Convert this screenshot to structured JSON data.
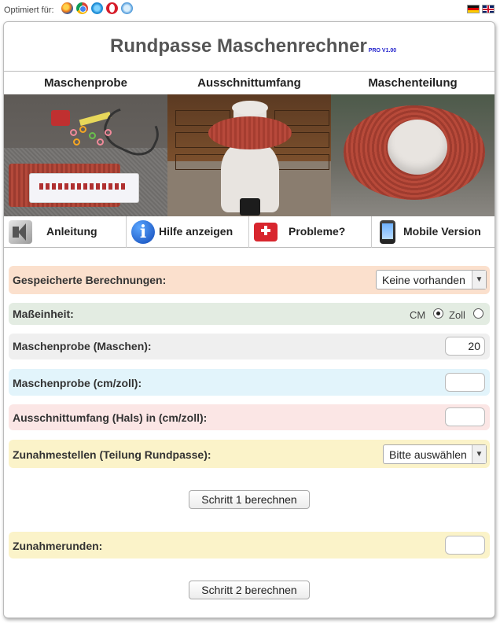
{
  "top": {
    "optimized_label": "Optimiert für:",
    "browsers": [
      "firefox-icon",
      "chrome-icon",
      "ie-icon",
      "opera-icon",
      "safari-icon"
    ],
    "flags": [
      "german-flag-icon",
      "english-flag-icon"
    ]
  },
  "header": {
    "title": "Rundpasse Maschenrechner",
    "version": "PRO V1.00"
  },
  "sections": [
    {
      "label": "Maschenprobe"
    },
    {
      "label": "Ausschnittumfang"
    },
    {
      "label": "Maschenteilung"
    }
  ],
  "nav": [
    {
      "label": "Anleitung",
      "icon": "speaker-icon"
    },
    {
      "label": "Hilfe anzeigen",
      "icon": "info-icon"
    },
    {
      "label": "Probleme?",
      "icon": "first-aid-kit-icon"
    },
    {
      "label": "Mobile Version",
      "icon": "smartphone-icon"
    }
  ],
  "form": {
    "saved": {
      "label": "Gespeicherte Berechnungen:",
      "value": "Keine vorhanden"
    },
    "unit": {
      "label": "Maßeinheit:",
      "options": [
        "CM",
        "Zoll"
      ],
      "selected": "CM"
    },
    "gauge_stitches": {
      "label": "Maschenprobe (Maschen):",
      "value": "20"
    },
    "gauge_length": {
      "label": "Maschenprobe (cm/zoll):",
      "value": ""
    },
    "neckline": {
      "label": "Ausschnittumfang (Hals) in (cm/zoll):",
      "value": ""
    },
    "increases": {
      "label": "Zunahmestellen (Teilung Rundpasse):",
      "value": "Bitte auswählen"
    },
    "step1_label": "Schritt 1 berechnen",
    "rounds": {
      "label": "Zunahmerunden:",
      "value": ""
    },
    "step2_label": "Schritt 2 berechnen"
  },
  "colors": {
    "saved_row": "#fbe0cd",
    "unit_row": "#e3ece2",
    "gauge_row": "#efefef",
    "gauge_cm_row": "#e2f4fb",
    "neck_row": "#fbe6e5",
    "increase_row": "#fbf3c9",
    "version_text": "#2222cc"
  }
}
